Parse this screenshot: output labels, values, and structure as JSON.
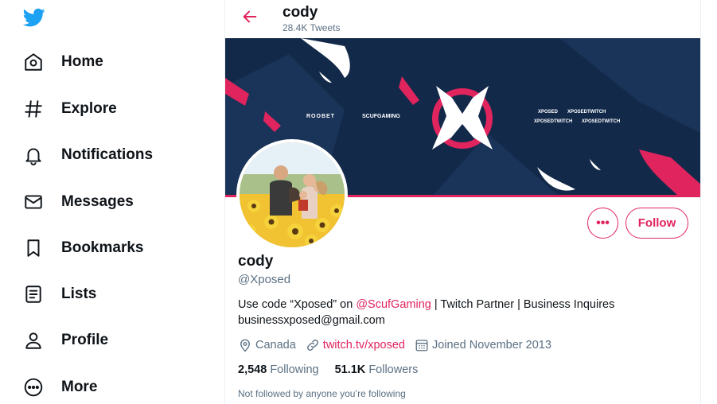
{
  "sidebar": {
    "logo_icon": "twitter-bird-icon",
    "items": [
      {
        "label": "Home",
        "icon": "home-icon"
      },
      {
        "label": "Explore",
        "icon": "hashtag-icon"
      },
      {
        "label": "Notifications",
        "icon": "bell-icon"
      },
      {
        "label": "Messages",
        "icon": "envelope-icon"
      },
      {
        "label": "Bookmarks",
        "icon": "bookmark-icon"
      },
      {
        "label": "Lists",
        "icon": "list-icon"
      },
      {
        "label": "Profile",
        "icon": "person-icon"
      },
      {
        "label": "More",
        "icon": "more-circle-icon"
      }
    ]
  },
  "header": {
    "name": "cody",
    "tweet_count": "28.4K Tweets"
  },
  "banner": {
    "sponsor_1": "ROOBET",
    "sponsor_2": "SCUFGAMING",
    "tags": [
      "XPOSED",
      "XPOSEDTWITCH",
      "XPOSEDTWITCH",
      "XPOSEDTWITCH"
    ]
  },
  "profile": {
    "name": "cody",
    "handle": "@Xposed",
    "bio_part1": "Use code “Xposed” on ",
    "bio_mention": "@ScufGaming",
    "bio_part2": " | Twitch Partner | Business Inquires businessxposed@gmail.com",
    "location": "Canada",
    "website": "twitch.tv/xposed",
    "joined": "Joined November 2013",
    "following_count": "2,548",
    "following_label": "Following",
    "followers_count": "51.1K",
    "followers_label": "Followers",
    "not_followed_text": "Not followed by anyone you’re following"
  },
  "actions": {
    "more_label": "•••",
    "follow_label": "Follow"
  },
  "colors": {
    "accent": "#e0245e",
    "twitter_blue": "#1da1f2",
    "banner_bg": "#13294a",
    "secondary_text": "#5b7083"
  }
}
